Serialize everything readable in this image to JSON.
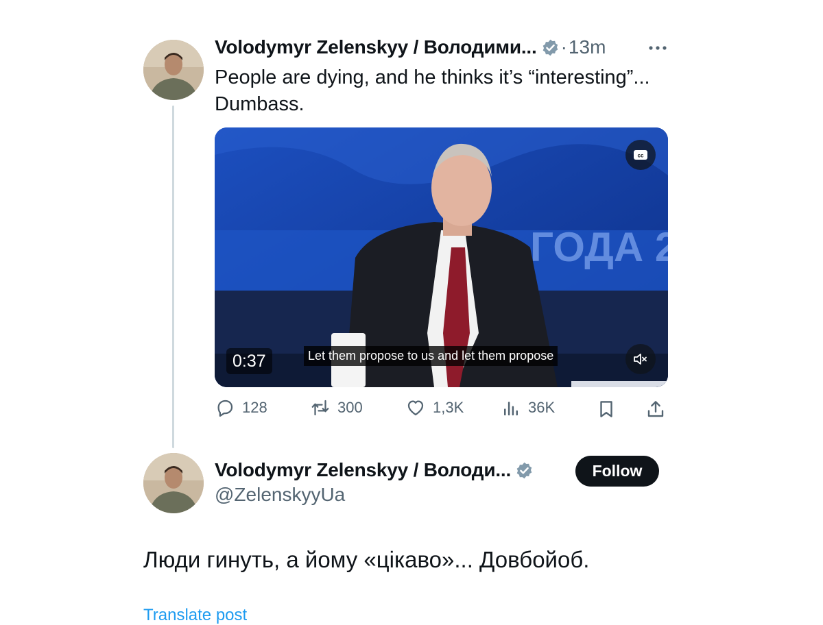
{
  "tweet": {
    "author_name": "Volodymyr Zelenskyy / Володими...",
    "separator": "·",
    "time": "13m",
    "text": "People are dying, and he thinks it’s “interesting”...\nDumbass.",
    "media": {
      "duration": "0:37",
      "caption": "Let them propose to us and let them propose",
      "background_banner_text": "ГОДА 2"
    },
    "actions": {
      "replies": "128",
      "reposts": "300",
      "likes": "1,3K",
      "views": "36K"
    }
  },
  "quoted_post": {
    "author_name": "Volodymyr Zelenskyy / Володи...",
    "handle": "@ZelenskyyUa",
    "follow_label": "Follow",
    "text": "Люди гинуть, а йому «цікаво»... Довбойоб.",
    "translate_label": "Translate post"
  },
  "icons": {
    "verified": "verified-badge-icon",
    "more": "more-icon",
    "cc": "closed-captions-icon",
    "mute": "volume-muted-icon",
    "reply": "reply-icon",
    "repost": "repost-icon",
    "like": "heart-icon",
    "views": "views-icon",
    "bookmark": "bookmark-icon",
    "share": "share-icon"
  },
  "colors": {
    "text_primary": "#0f1419",
    "text_secondary": "#536471",
    "verified_badge": "#829aab",
    "link": "#1d9bf0",
    "thread_line": "#cfd9de"
  }
}
